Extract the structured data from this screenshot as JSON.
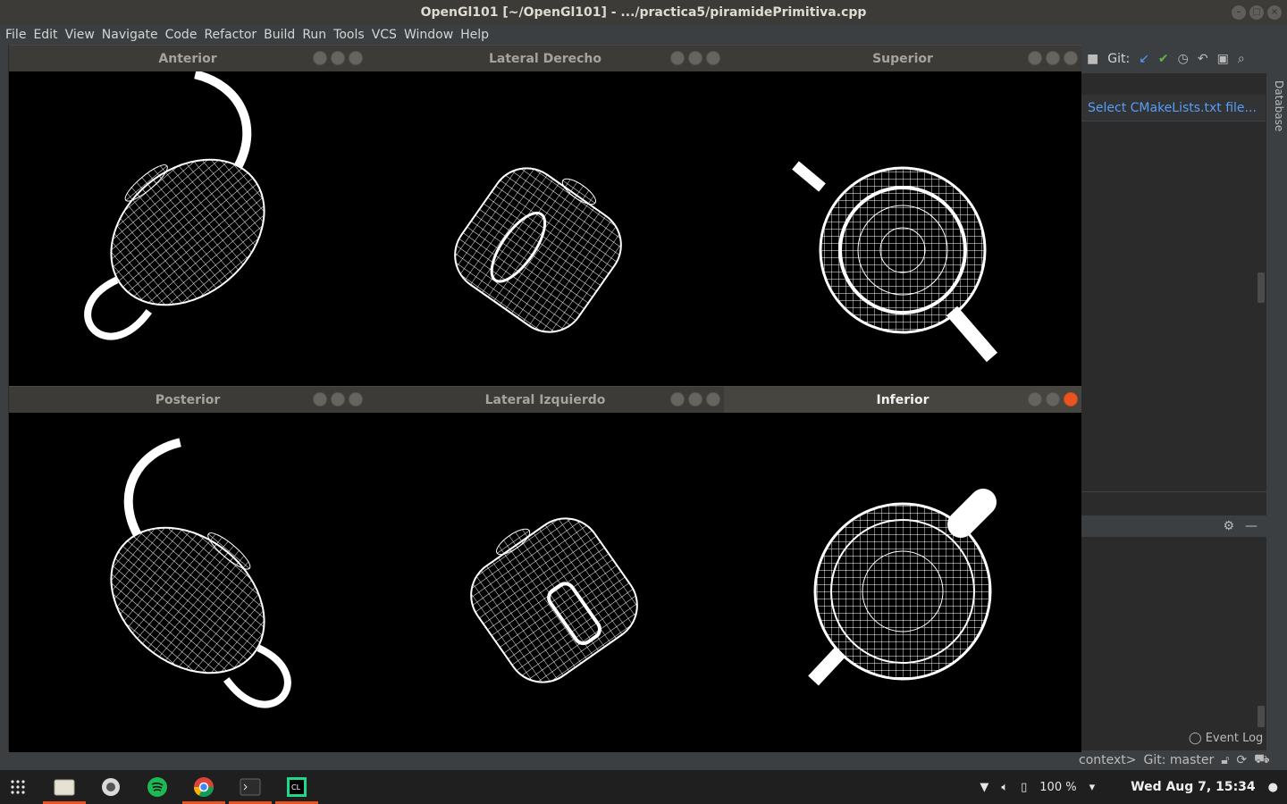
{
  "window_title": "OpenGl101 [~/OpenGl101] - .../practica5/piramidePrimitiva.cpp",
  "menu": [
    "File",
    "Edit",
    "View",
    "Navigate",
    "Code",
    "Refactor",
    "Build",
    "Run",
    "Tools",
    "VCS",
    "Window",
    "Help"
  ],
  "ide": {
    "git_label": "Git:",
    "cmake_banner": "Select CMakeLists.txt file...",
    "database_label": "Database",
    "event_log": "Event Log",
    "status_context": "context>",
    "status_branch": "Git: master"
  },
  "gl_windows": [
    {
      "title": "Anterior",
      "view": "teapot-front"
    },
    {
      "title": "Lateral Derecho",
      "view": "teapot-right"
    },
    {
      "title": "Superior",
      "view": "teapot-top"
    },
    {
      "title": "Posterior",
      "view": "teapot-back"
    },
    {
      "title": "Lateral Izquierdo",
      "view": "teapot-left"
    },
    {
      "title": "Inferior",
      "view": "teapot-bottom"
    }
  ],
  "taskbar": {
    "apps": [
      "apps-grid-icon",
      "files-icon",
      "settings-icon",
      "spotify-icon",
      "chrome-icon",
      "terminal-icon",
      "clion-icon"
    ],
    "battery": "100 %",
    "clock": "Wed Aug  7, 15:34"
  },
  "colors": {
    "accent": "#e95420",
    "link": "#589df6",
    "ide_bg": "#2b2b2b",
    "wireframe": "#ffffff"
  }
}
